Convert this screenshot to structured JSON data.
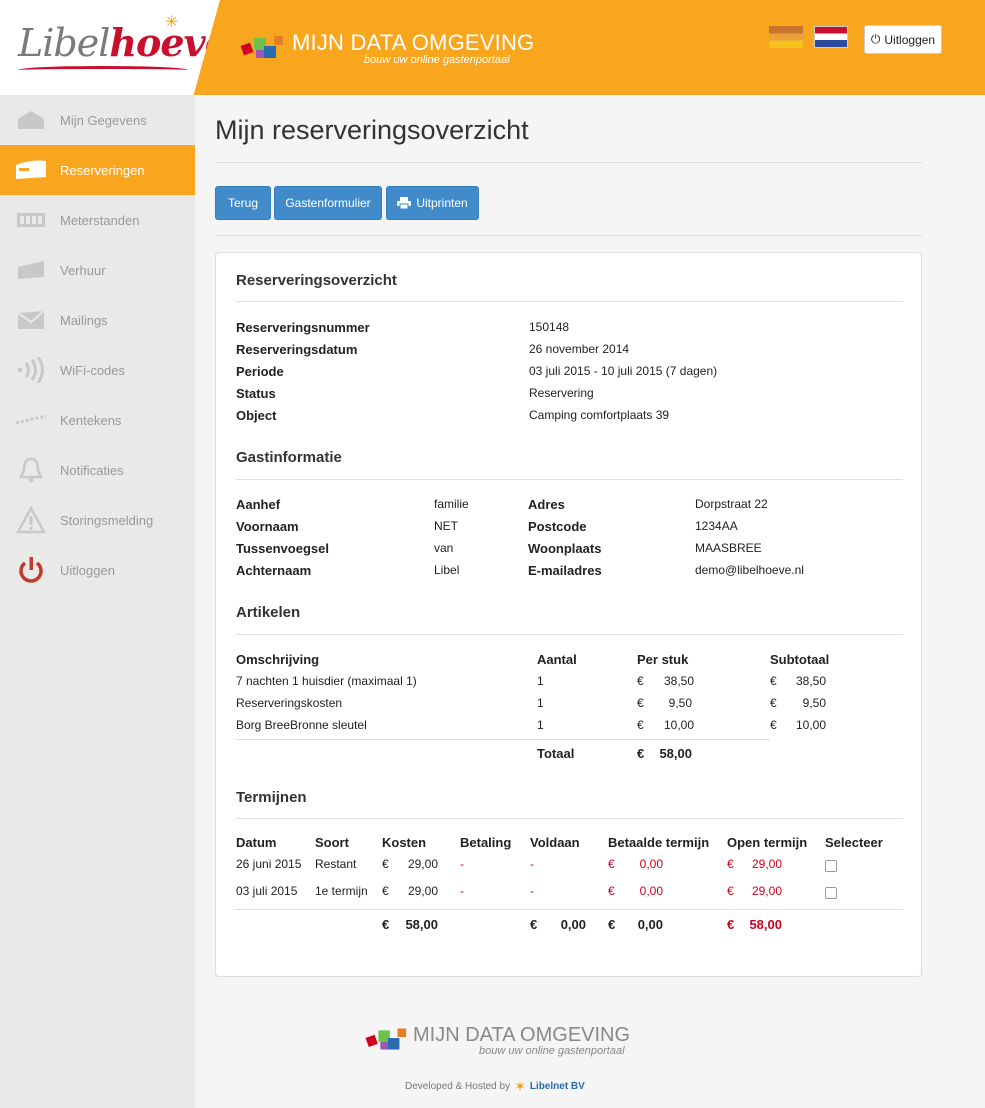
{
  "header": {
    "logo": "Libelhoeve",
    "brand_title": "MIJN DATA OMGEVING",
    "brand_subtitle": "bouw uw online gastenportaal",
    "logout_label": "Uitloggen"
  },
  "sidebar": {
    "items": [
      {
        "label": "Mijn Gegevens",
        "icon": "home-icon"
      },
      {
        "label": "Reserveringen",
        "icon": "caravan-icon",
        "active": true
      },
      {
        "label": "Meterstanden",
        "icon": "meter-icon"
      },
      {
        "label": "Verhuur",
        "icon": "trailer-icon"
      },
      {
        "label": "Mailings",
        "icon": "envelope-icon"
      },
      {
        "label": "WiFi-codes",
        "icon": "wifi-icon"
      },
      {
        "label": "Kentekens",
        "icon": "key-icon"
      },
      {
        "label": "Notificaties",
        "icon": "bell-icon"
      },
      {
        "label": "Storingsmelding",
        "icon": "warning-icon"
      },
      {
        "label": "Uitloggen",
        "icon": "power-icon"
      }
    ]
  },
  "page": {
    "title": "Mijn reserveringsoverzicht",
    "buttons": {
      "back": "Terug",
      "guestform": "Gastenformulier",
      "print": "Uitprinten"
    }
  },
  "overview": {
    "title": "Reserveringsoverzicht",
    "rows": [
      {
        "label": "Reserveringsnummer",
        "value": "150148"
      },
      {
        "label": "Reserveringsdatum",
        "value": "26 november 2014"
      },
      {
        "label": "Periode",
        "value": "03 juli 2015 - 10 juli 2015 (7 dagen)"
      },
      {
        "label": "Status",
        "value": "Reservering"
      },
      {
        "label": "Object",
        "value": "Camping comfortplaats 39"
      }
    ]
  },
  "guest": {
    "title": "Gastinformatie",
    "left": [
      {
        "label": "Aanhef",
        "value": "familie"
      },
      {
        "label": "Voornaam",
        "value": "NET"
      },
      {
        "label": "Tussenvoegsel",
        "value": "van"
      },
      {
        "label": "Achternaam",
        "value": "Libel"
      }
    ],
    "right": [
      {
        "label": "Adres",
        "value": "Dorpstraat 22"
      },
      {
        "label": "Postcode",
        "value": "1234AA"
      },
      {
        "label": "Woonplaats",
        "value": "MAASBREE"
      },
      {
        "label": "E-mailadres",
        "value": "demo@libelhoeve.nl"
      }
    ]
  },
  "articles": {
    "title": "Artikelen",
    "headers": {
      "desc": "Omschrijving",
      "qty": "Aantal",
      "unit": "Per stuk",
      "sub": "Subtotaal"
    },
    "currency": "€",
    "rows": [
      {
        "desc": "7 nachten 1 huisdier (maximaal 1)",
        "qty": "1",
        "unit": "38,50",
        "sub": "38,50"
      },
      {
        "desc": "Reserveringskosten",
        "qty": "1",
        "unit": "9,50",
        "sub": "9,50"
      },
      {
        "desc": "Borg BreeBronne sleutel",
        "qty": "1",
        "unit": "10,00",
        "sub": "10,00"
      }
    ],
    "total_label": "Totaal",
    "total": "58,00"
  },
  "terms": {
    "title": "Termijnen",
    "headers": {
      "date": "Datum",
      "type": "Soort",
      "cost": "Kosten",
      "payment": "Betaling",
      "paid": "Voldaan",
      "paid_terms": "Betaalde termijn",
      "open_terms": "Open termijn",
      "select": "Selecteer"
    },
    "currency": "€",
    "rows": [
      {
        "date": "26 juni 2015",
        "type": "Restant",
        "cost": "29,00",
        "payment": "-",
        "paid": "-",
        "paid_terms": "0,00",
        "open_terms": "29,00"
      },
      {
        "date": "03 juli 2015",
        "type": "1e termijn",
        "cost": "29,00",
        "payment": "-",
        "paid": "-",
        "paid_terms": "0,00",
        "open_terms": "29,00"
      }
    ],
    "totals": {
      "cost": "58,00",
      "paid": "0,00",
      "paid_terms": "0,00",
      "open_terms": "58,00"
    }
  },
  "footer": {
    "brand_title": "MIJN DATA OMGEVING",
    "brand_subtitle": "bouw uw online gastenportaal",
    "developed": "Developed & Hosted by",
    "company": "Libelnet BV"
  }
}
